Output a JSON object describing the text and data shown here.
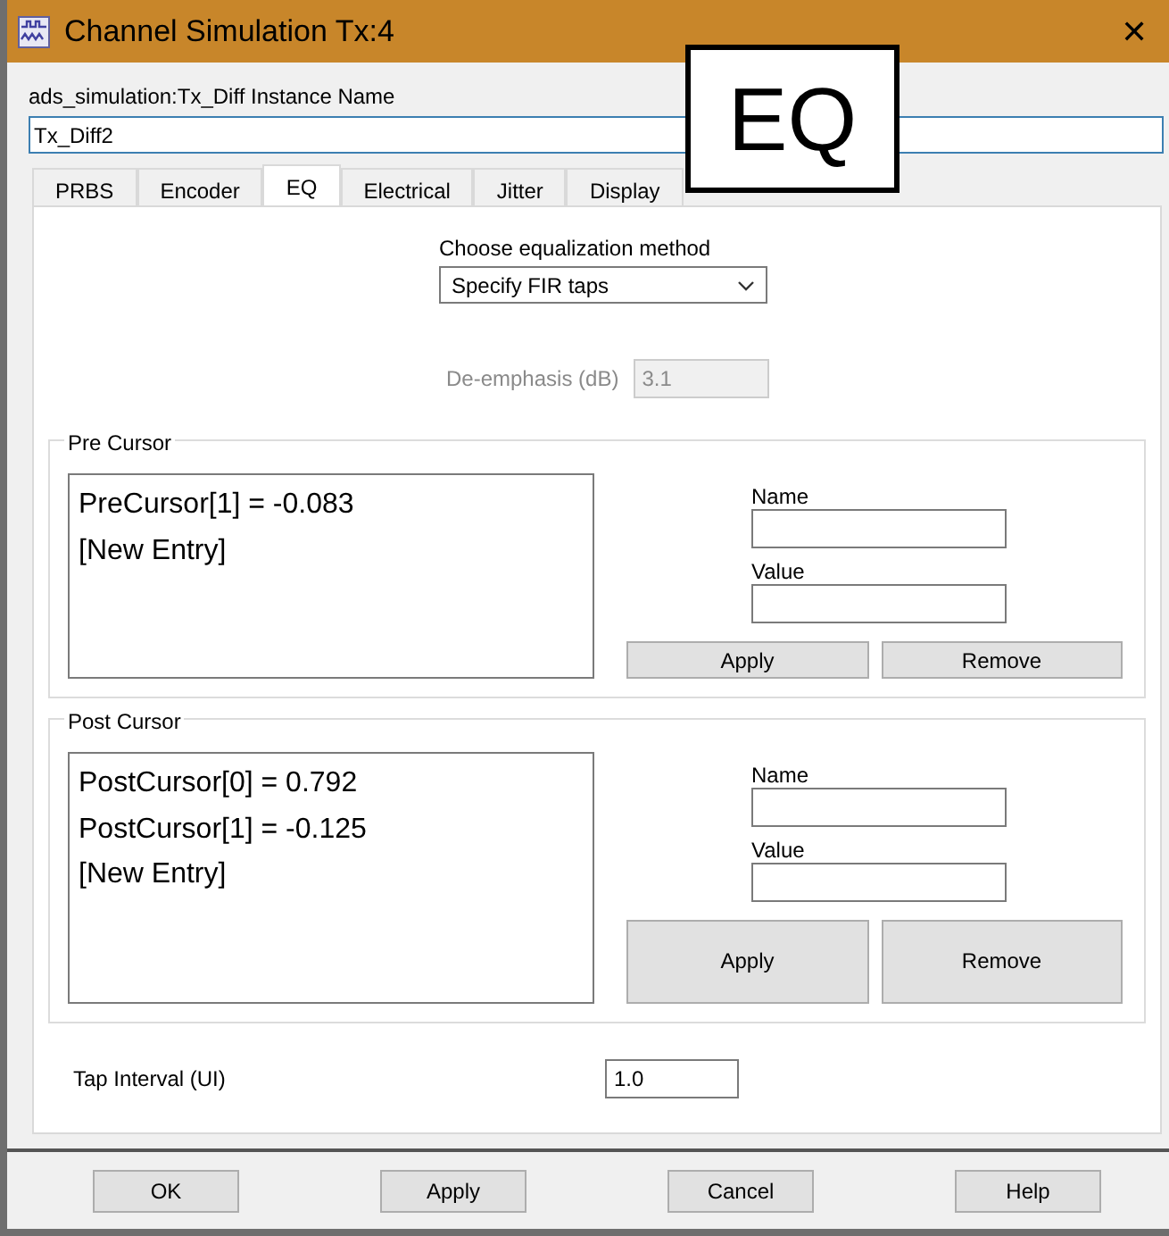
{
  "window": {
    "title": "Channel Simulation Tx:4",
    "close": "✕"
  },
  "instance": {
    "label": "ads_simulation:Tx_Diff Instance Name",
    "value": "Tx_Diff2"
  },
  "tabs": [
    {
      "label": "PRBS",
      "selected": false
    },
    {
      "label": "Encoder",
      "selected": false
    },
    {
      "label": "EQ",
      "selected": true
    },
    {
      "label": "Electrical",
      "selected": false
    },
    {
      "label": "Jitter",
      "selected": false
    },
    {
      "label": "Display",
      "selected": false
    }
  ],
  "callout": {
    "text": "EQ"
  },
  "eq": {
    "method": {
      "label": "Choose equalization method",
      "value": "Specify FIR taps"
    },
    "deemphasis": {
      "label": "De-emphasis (dB)",
      "value": "3.1",
      "disabled": true
    },
    "groups": [
      {
        "title": "Pre Cursor",
        "entries": [
          "PreCursor[1] = -0.083",
          "[New Entry]"
        ],
        "name_label": "Name",
        "value_label": "Value",
        "buttons": [
          "Apply",
          "Remove"
        ]
      },
      {
        "title": "Post Cursor",
        "entries": [
          "PostCursor[0] = 0.792",
          "PostCursor[1] = -0.125",
          "[New Entry]"
        ],
        "name_label": "Name",
        "value_label": "Value",
        "buttons": [
          "Apply",
          "Remove"
        ]
      }
    ],
    "tap_interval": {
      "label": "Tap Interval (UI)",
      "value": "1.0"
    }
  },
  "buttons": [
    "OK",
    "Apply",
    "Cancel",
    "Help"
  ]
}
